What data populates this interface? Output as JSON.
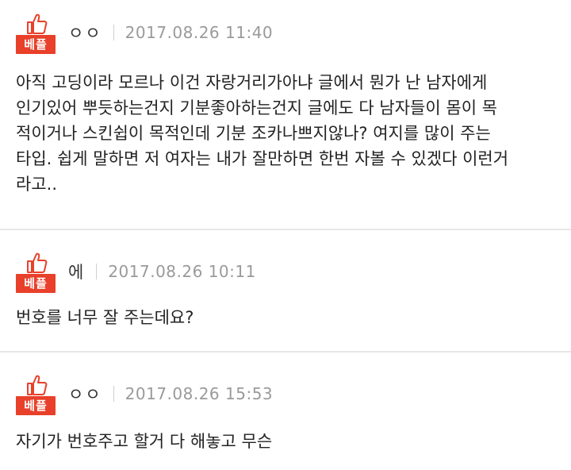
{
  "comments": [
    {
      "badge": "베플",
      "author": "ㅇㅇ",
      "date": "2017.08.26 11:40",
      "body": "아직 고딩이라 모르나 이건 자랑거리가아냐 글에서 뭔가 난 남자에게\n인기있어 뿌듯하는건지 기분좋아하는건지 글에도 다 남자들이 몸이 목\n적이거나 스킨쉽이 목적인데 기분 조카나쁘지않나? 여지를 많이 주는\n타입. 쉽게 말하면 저 여자는 내가 잘만하면 한번 자볼 수 있겠다 이런거\n라고.."
    },
    {
      "badge": "베플",
      "author": "에",
      "date": "2017.08.26 10:11",
      "body": "번호를 너무 잘 주는데요?"
    },
    {
      "badge": "베플",
      "author": "ㅇㅇ",
      "date": "2017.08.26 15:53",
      "body": "자기가 번호주고 할거 다 해놓고 무슨"
    }
  ],
  "colors": {
    "badge": "#e8402a",
    "date": "#9a9a9a",
    "divider": "#e6e6e6"
  },
  "icons": {
    "best": "thumbs-up-icon"
  }
}
